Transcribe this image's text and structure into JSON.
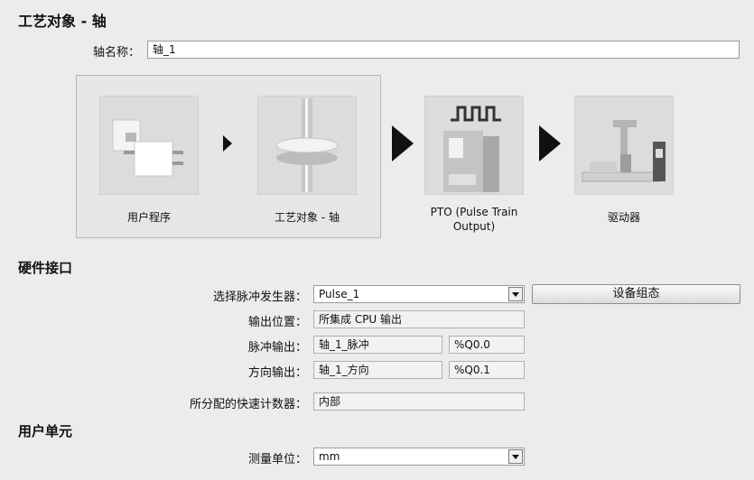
{
  "title": "工艺对象 - 轴",
  "axis_name": {
    "label": "轴名称：",
    "value": "轴_1"
  },
  "diagram": {
    "user_program": "用户程序",
    "tech_object": "工艺对象 - 轴",
    "pto_line1": "PTO (Pulse Train",
    "pto_line2": "Output)",
    "drive": "驱动器"
  },
  "hardware": {
    "heading": "硬件接口",
    "pulse_gen_label": "选择脉冲发生器：",
    "pulse_gen_value": "Pulse_1",
    "device_config_button": "设备组态",
    "output_pos_label": "输出位置：",
    "output_pos_value": "所集成 CPU 输出",
    "pulse_out_label": "脉冲输出：",
    "pulse_out_value": "轴_1_脉冲",
    "pulse_out_addr": "%Q0.0",
    "dir_out_label": "方向输出：",
    "dir_out_value": "轴_1_方向",
    "dir_out_addr": "%Q0.1",
    "hsc_label": "所分配的快速计数器：",
    "hsc_value": "内部"
  },
  "units": {
    "heading": "用户单元",
    "measure_label": "测量单位：",
    "measure_value": "mm"
  }
}
